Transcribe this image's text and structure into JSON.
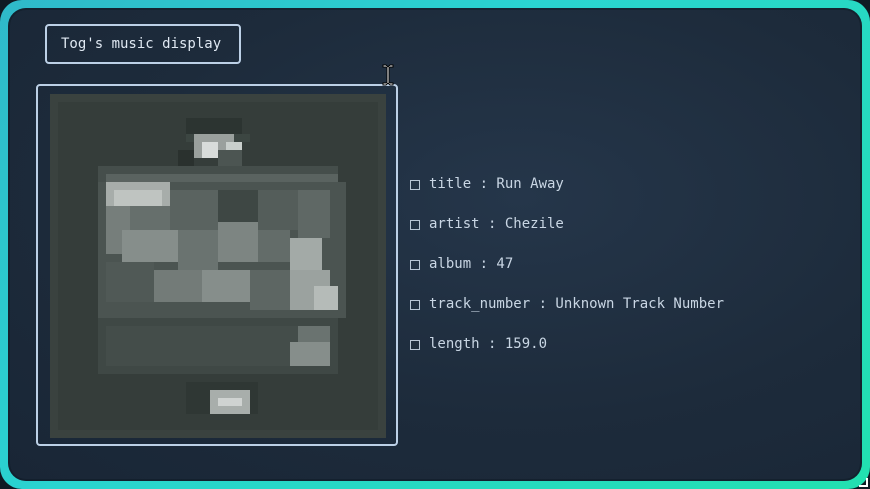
{
  "window": {
    "title": "Tog's music display"
  },
  "album_art": {
    "icon": "album-cover-image",
    "palette_dark": "#3a423f",
    "palette_light": "#d0d4d2"
  },
  "track_info": [
    {
      "label": "title : Run Away"
    },
    {
      "label": "artist : Chezile"
    },
    {
      "label": "album : 47"
    },
    {
      "label": "track_number : Unknown Track Number"
    },
    {
      "label": "length : 159.0"
    }
  ],
  "colors": {
    "border_gradient_start": "#2fb9c9",
    "border_gradient_end": "#22e0b0",
    "panel_bg": "#1d2b3b",
    "box_border": "#bcd0e6",
    "text": "#c9d6e4"
  }
}
